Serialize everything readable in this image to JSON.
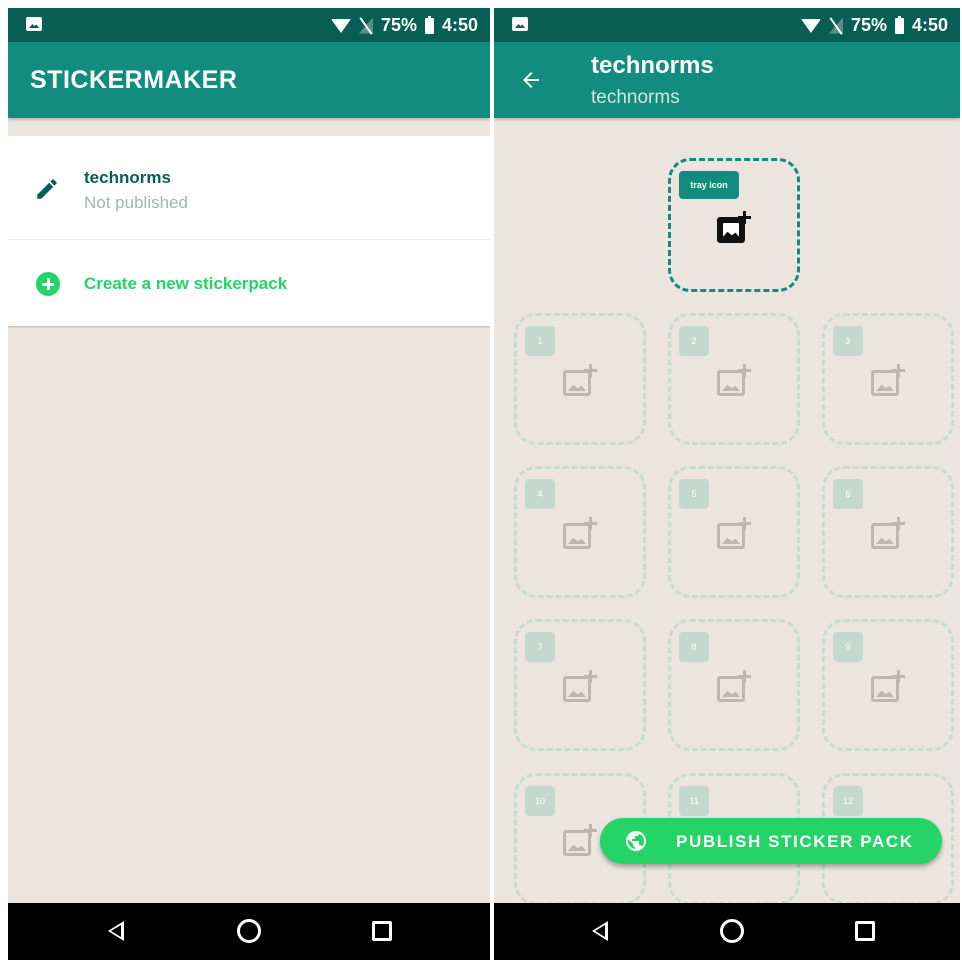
{
  "left_screen": {
    "status_bar": {
      "battery": "75%",
      "time": "4:50"
    },
    "app_bar": {
      "title": "STICKERMAKER"
    },
    "packs": [
      {
        "name": "technorms",
        "status": "Not published"
      }
    ],
    "create_label": "Create a new stickerpack"
  },
  "right_screen": {
    "status_bar": {
      "battery": "75%",
      "time": "4:50"
    },
    "app_bar": {
      "title": "technorms",
      "subtitle": "technorms"
    },
    "tray_slot": {
      "label": "tray icon",
      "icon": "add-image-icon"
    },
    "sticker_slots": [
      "1",
      "2",
      "3",
      "4",
      "5",
      "6",
      "7",
      "8",
      "9",
      "10",
      "11",
      "12"
    ],
    "publish_button": {
      "label": "PUBLISH STICKER PACK",
      "icon": "globe-icon"
    }
  },
  "icons": {
    "status_left": "image-notification-icon",
    "wifi": "wifi-icon",
    "signal": "no-signal-icon",
    "battery": "battery-icon",
    "nav": [
      "nav-back-icon",
      "nav-home-icon",
      "nav-recents-icon"
    ]
  },
  "colors": {
    "primary_dark": "#075e54",
    "primary": "#128c7e",
    "accent": "#25d366",
    "background": "#ece5df"
  }
}
